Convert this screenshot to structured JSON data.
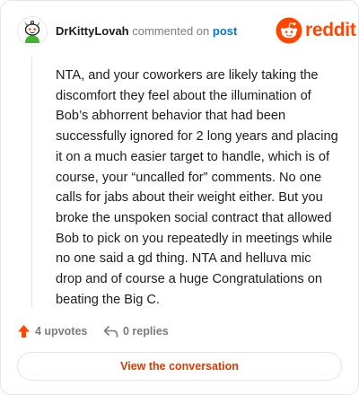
{
  "header": {
    "username": "DrKittyLovah",
    "action_text": "commented on",
    "post_link": "post",
    "brand_name": "reddit",
    "avatar_icon": "snoo-avatar-icon",
    "brand_icon": "reddit-snoo-icon"
  },
  "comment": {
    "body": "NTA, and your coworkers are likely taking the discomfort they feel about the illumination of Bob’s abhorrent behavior that had been successfully ignored for 2 long years and placing it on a much easier target to handle, which is of course, your “uncalled for” comments. No one calls for jabs about their weight either. But you broke the unspoken social contract that allowed Bob to pick on you repeatedly in meetings while no one said a gd thing. NTA and helluva mic drop and of course a huge Congratulations on beating the Big C."
  },
  "stats": {
    "upvotes_label": "4 upvotes",
    "replies_label": "0 replies",
    "upvote_icon": "upvote-arrow-icon",
    "reply_icon": "reply-arrow-icon"
  },
  "cta": {
    "label": "View the conversation"
  },
  "colors": {
    "brand": "#ff4500",
    "link": "#0079d3",
    "cta_text": "#d93a00",
    "muted": "#7c7c7c",
    "text": "#1c1c1c",
    "border": "#e3e5e8",
    "avatar_green": "#46b035"
  }
}
